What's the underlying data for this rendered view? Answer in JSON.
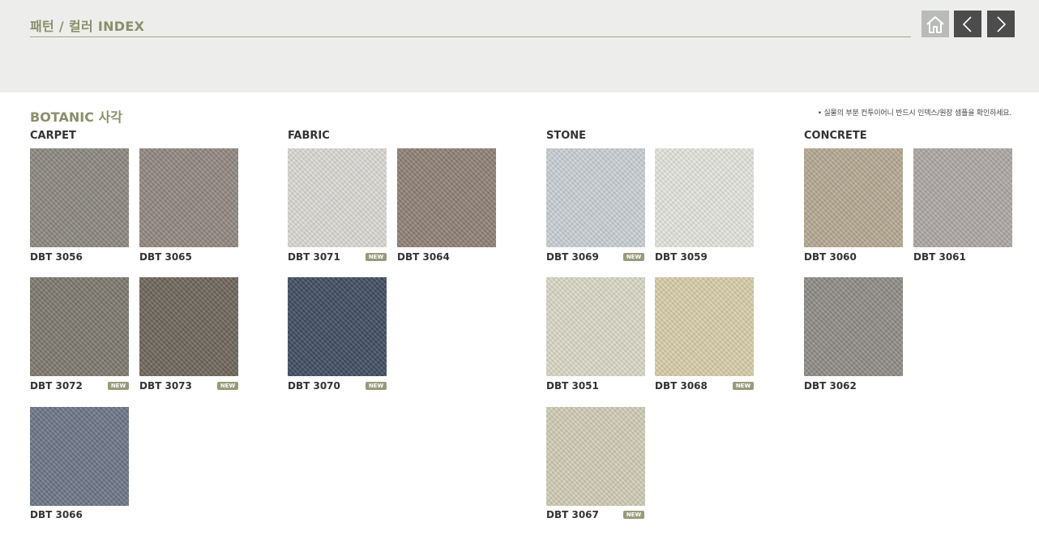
{
  "header": {
    "title": "패턴 / 컬러 INDEX"
  },
  "section": {
    "title": "BOTANIC 사각",
    "notice": "• 실물의 부분 컨투이어니 반드시 인덱스/원장 샘플을 확인하세요."
  },
  "categories": {
    "carpet": "CARPET",
    "fabric": "FABRIC",
    "stone": "STONE",
    "concrete": "CONCRETE"
  },
  "new_label": "NEW",
  "swatches": {
    "s3056": {
      "code": "DBT 3056",
      "color": "#8b877f"
    },
    "s3065": {
      "code": "DBT 3065",
      "color": "#918680"
    },
    "s3072": {
      "code": "DBT 3072",
      "color": "#7c776d",
      "new": true
    },
    "s3073": {
      "code": "DBT 3073",
      "color": "#6d6459",
      "new": true
    },
    "s3066": {
      "code": "DBT 3066",
      "color": "#6b7486"
    },
    "s3071": {
      "code": "DBT 3071",
      "color": "#d9d8d3",
      "new": true
    },
    "s3064": {
      "code": "DBT 3064",
      "color": "#8e7f75"
    },
    "s3070": {
      "code": "DBT 3070",
      "color": "#3e4c5f",
      "new": true
    },
    "s3069": {
      "code": "DBT 3069",
      "color": "#c9ced3",
      "new": true
    },
    "s3059": {
      "code": "DBT 3059",
      "color": "#e2e3dc"
    },
    "s3051": {
      "code": "DBT 3051",
      "color": "#d8d7c6"
    },
    "s3068": {
      "code": "DBT 3068",
      "color": "#d6cca8",
      "new": true
    },
    "s3067": {
      "code": "DBT 3067",
      "color": "#cfcbb5",
      "new": true
    },
    "s3060": {
      "code": "DBT 3060",
      "color": "#b5a891"
    },
    "s3061": {
      "code": "DBT 3061",
      "color": "#aca7a4"
    },
    "s3062": {
      "code": "DBT 3062",
      "color": "#8e8b86"
    }
  }
}
